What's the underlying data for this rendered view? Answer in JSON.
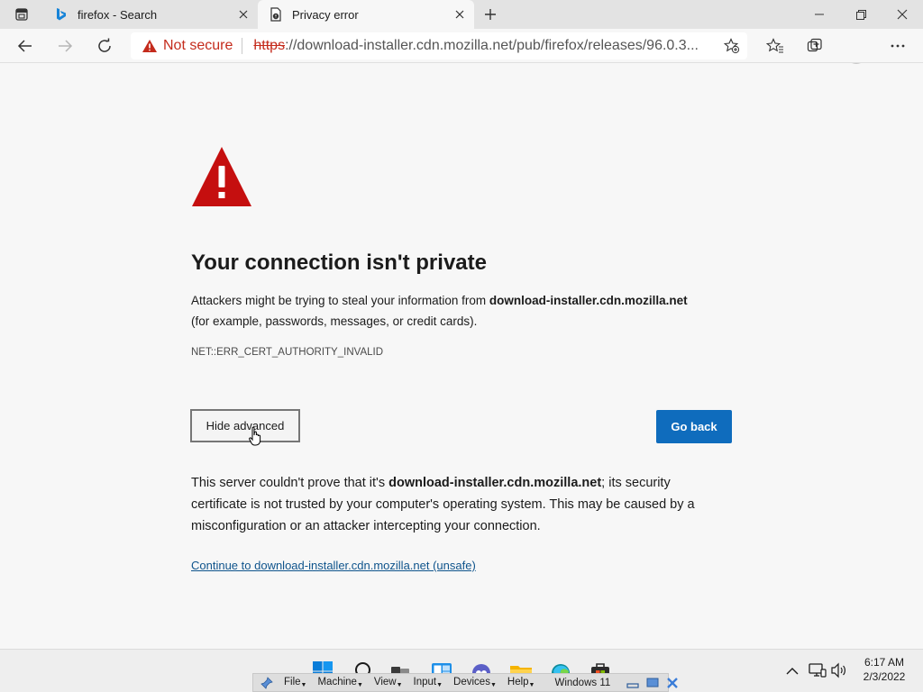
{
  "tabs": [
    {
      "title": "firefox - Search",
      "active": false
    },
    {
      "title": "Privacy error",
      "active": true
    }
  ],
  "address_bar": {
    "security_label": "Not secure",
    "url_scheme": "https",
    "url_rest": "://download-installer.cdn.mozilla.net/pub/firefox/releases/96.0.3..."
  },
  "page": {
    "title": "Your connection isn't private",
    "intro_text": "Attackers might be trying to steal your information from ",
    "domain": "download-installer.cdn.mozilla.net",
    "intro_text_2": "(for example, passwords, messages, or credit cards).",
    "error_code": "NET::ERR_CERT_AUTHORITY_INVALID",
    "hide_advanced_label": "Hide advanced",
    "go_back_label": "Go back",
    "advanced_text_1": "This server couldn't prove that it's ",
    "advanced_text_2": "; its security certificate is not trusted by your computer's operating system. This may be caused by a misconfiguration or an attacker intercepting your connection.",
    "continue_link": "Continue to download-installer.cdn.mozilla.net (unsafe)"
  },
  "taskbar": {
    "apps": [
      "start-icon",
      "search-icon",
      "task-view-icon",
      "widgets-icon",
      "teams-chat-icon",
      "file-explorer-icon",
      "edge-icon",
      "store-icon"
    ],
    "clock_time": "6:17 AM",
    "clock_date": "2/3/2022"
  },
  "vbox_bar": {
    "menus": [
      "File",
      "Machine",
      "View",
      "Input",
      "Devices",
      "Help"
    ],
    "vm_name": "Windows 11"
  },
  "colors": {
    "accent": "#0f6cbd",
    "warning_red": "#c42b1c",
    "link": "#0f548c"
  }
}
